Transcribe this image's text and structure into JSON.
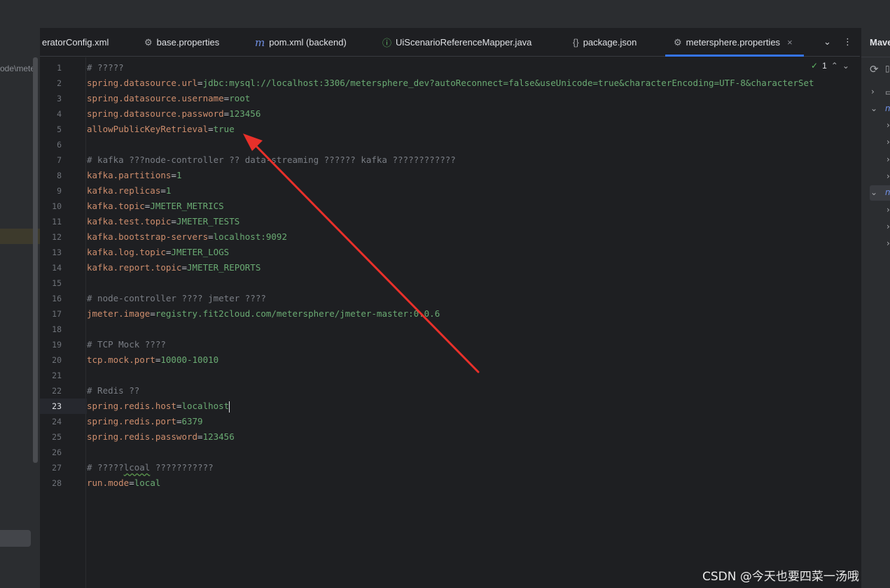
{
  "tabs": [
    {
      "label": "eratorConfig.xml",
      "icon": "xml-file-icon",
      "icon_glyph": ""
    },
    {
      "label": "base.properties",
      "icon": "gear-icon",
      "icon_glyph": "⚙"
    },
    {
      "label": "pom.xml (backend)",
      "icon": "maven-icon",
      "icon_glyph": "m"
    },
    {
      "label": "UiScenarioReferenceMapper.java",
      "icon": "interface-icon",
      "icon_glyph": "ⓘ"
    },
    {
      "label": "package.json",
      "icon": "json-icon",
      "icon_glyph": "{}"
    },
    {
      "label": "metersphere.properties",
      "icon": "gear-icon",
      "icon_glyph": "⚙",
      "active": true
    }
  ],
  "tab_tools": {
    "dropdown_glyph": "⌄",
    "more_glyph": "⋮"
  },
  "left_panel": {
    "path": "ode\\mete"
  },
  "right_panel": {
    "title": "Mave"
  },
  "inspection": {
    "count": "1",
    "check": "✓",
    "up": "⌃",
    "down": "⌄"
  },
  "current_line": 23,
  "lines": [
    {
      "n": "1",
      "parts": [
        {
          "t": "c",
          "s": "# ?????"
        }
      ]
    },
    {
      "n": "2",
      "parts": [
        {
          "t": "k",
          "s": "spring.datasource.url"
        },
        {
          "t": "eq",
          "s": "="
        },
        {
          "t": "v",
          "s": "jdbc:mysql://localhost:3306/metersphere_dev?autoReconnect=false&useUnicode=true&characterEncoding=UTF-8&characterSet"
        }
      ]
    },
    {
      "n": "3",
      "parts": [
        {
          "t": "k",
          "s": "spring.datasource.username"
        },
        {
          "t": "eq",
          "s": "="
        },
        {
          "t": "v",
          "s": "root"
        }
      ]
    },
    {
      "n": "4",
      "parts": [
        {
          "t": "k",
          "s": "spring.datasource.password"
        },
        {
          "t": "eq",
          "s": "="
        },
        {
          "t": "v",
          "s": "123456"
        }
      ]
    },
    {
      "n": "5",
      "parts": [
        {
          "t": "k",
          "s": "allowPublicKeyRetrieval"
        },
        {
          "t": "eq",
          "s": "="
        },
        {
          "t": "v",
          "s": "true"
        }
      ]
    },
    {
      "n": "6",
      "parts": []
    },
    {
      "n": "7",
      "parts": [
        {
          "t": "c",
          "s": "# kafka ???node-controller ?? data-streaming ?????? kafka ????????????"
        }
      ]
    },
    {
      "n": "8",
      "parts": [
        {
          "t": "k",
          "s": "kafka.partitions"
        },
        {
          "t": "eq",
          "s": "="
        },
        {
          "t": "v",
          "s": "1"
        }
      ]
    },
    {
      "n": "9",
      "parts": [
        {
          "t": "k",
          "s": "kafka.replicas"
        },
        {
          "t": "eq",
          "s": "="
        },
        {
          "t": "v",
          "s": "1"
        }
      ]
    },
    {
      "n": "10",
      "parts": [
        {
          "t": "k",
          "s": "kafka.topic"
        },
        {
          "t": "eq",
          "s": "="
        },
        {
          "t": "v",
          "s": "JMETER_METRICS"
        }
      ]
    },
    {
      "n": "11",
      "parts": [
        {
          "t": "k",
          "s": "kafka.test.topic"
        },
        {
          "t": "eq",
          "s": "="
        },
        {
          "t": "v",
          "s": "JMETER_TESTS"
        }
      ]
    },
    {
      "n": "12",
      "parts": [
        {
          "t": "k",
          "s": "kafka.bootstrap-servers"
        },
        {
          "t": "eq",
          "s": "="
        },
        {
          "t": "v",
          "s": "localhost:9092"
        }
      ]
    },
    {
      "n": "13",
      "parts": [
        {
          "t": "k",
          "s": "kafka.log.topic"
        },
        {
          "t": "eq",
          "s": "="
        },
        {
          "t": "v",
          "s": "JMETER_LOGS"
        }
      ]
    },
    {
      "n": "14",
      "parts": [
        {
          "t": "k",
          "s": "kafka.report.topic"
        },
        {
          "t": "eq",
          "s": "="
        },
        {
          "t": "v",
          "s": "JMETER_REPORTS"
        }
      ]
    },
    {
      "n": "15",
      "parts": []
    },
    {
      "n": "16",
      "parts": [
        {
          "t": "c",
          "s": "# node-controller ???? jmeter ????"
        }
      ]
    },
    {
      "n": "17",
      "parts": [
        {
          "t": "k",
          "s": "jmeter.image"
        },
        {
          "t": "eq",
          "s": "="
        },
        {
          "t": "v",
          "s": "registry.fit2cloud.com/metersphere/jmeter-master:0.0.6"
        }
      ]
    },
    {
      "n": "18",
      "parts": []
    },
    {
      "n": "19",
      "parts": [
        {
          "t": "c",
          "s": "# TCP Mock ????"
        }
      ]
    },
    {
      "n": "20",
      "parts": [
        {
          "t": "k",
          "s": "tcp.mock.port"
        },
        {
          "t": "eq",
          "s": "="
        },
        {
          "t": "v",
          "s": "10000-10010"
        }
      ]
    },
    {
      "n": "21",
      "parts": []
    },
    {
      "n": "22",
      "parts": [
        {
          "t": "c",
          "s": "# Redis ??"
        }
      ]
    },
    {
      "n": "23",
      "parts": [
        {
          "t": "k",
          "s": "spring.redis.host"
        },
        {
          "t": "eq",
          "s": "="
        },
        {
          "t": "v",
          "s": "localhost"
        }
      ],
      "caret": true
    },
    {
      "n": "24",
      "parts": [
        {
          "t": "k",
          "s": "spring.redis.port"
        },
        {
          "t": "eq",
          "s": "="
        },
        {
          "t": "v",
          "s": "6379"
        }
      ]
    },
    {
      "n": "25",
      "parts": [
        {
          "t": "k",
          "s": "spring.redis.password"
        },
        {
          "t": "eq",
          "s": "="
        },
        {
          "t": "v",
          "s": "123456"
        }
      ]
    },
    {
      "n": "26",
      "parts": []
    },
    {
      "n": "27",
      "parts": [
        {
          "t": "c",
          "s": "# ?????"
        },
        {
          "t": "c sq",
          "s": "lcoal"
        },
        {
          "t": "c",
          "s": " ???????????"
        }
      ]
    },
    {
      "n": "28",
      "parts": [
        {
          "t": "k",
          "s": "run.mode"
        },
        {
          "t": "eq",
          "s": "="
        },
        {
          "t": "v",
          "s": "local"
        }
      ]
    }
  ],
  "annotation": {
    "color": "#e8302a",
    "points_to": "allowPublicKeyRetrieval=true"
  },
  "watermark": "CSDN @今天也要四菜一汤哦",
  "colors": {
    "key": "#cf8e6d",
    "value": "#6aab73",
    "comment": "#7a7e85",
    "accent": "#3574f0"
  }
}
